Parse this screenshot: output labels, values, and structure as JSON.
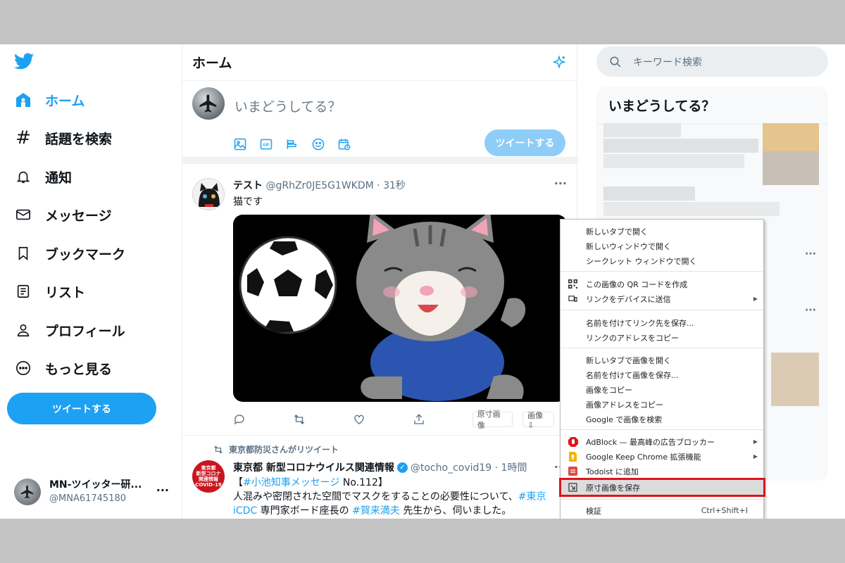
{
  "sidebar": {
    "logo": "twitter-bird-icon",
    "nav": [
      {
        "label": "ホーム",
        "icon": "home-icon",
        "active": true
      },
      {
        "label": "話題を検索",
        "icon": "hashtag-icon"
      },
      {
        "label": "通知",
        "icon": "bell-icon"
      },
      {
        "label": "メッセージ",
        "icon": "mail-icon"
      },
      {
        "label": "ブックマーク",
        "icon": "bookmark-icon"
      },
      {
        "label": "リスト",
        "icon": "list-icon"
      },
      {
        "label": "プロフィール",
        "icon": "person-icon"
      },
      {
        "label": "もっと見る",
        "icon": "more-circle-icon"
      }
    ],
    "tweet_button": "ツイートする",
    "account": {
      "name": "MN-ツイッター研...",
      "handle": "@MNA61745180",
      "more": "···"
    }
  },
  "home": {
    "title": "ホーム",
    "compose": {
      "placeholder": "いまどうしてる？",
      "tools": [
        "image-icon",
        "gif-icon",
        "poll-icon",
        "emoji-icon",
        "schedule-icon"
      ],
      "tweet_button": "ツイートする"
    },
    "tweet1": {
      "name": "テスト",
      "meta": "@gRhZr0JE5G1WKDM · 31秒",
      "body": "猫です",
      "more": "···",
      "ext_buttons": [
        "原寸画像",
        "画像⇩"
      ]
    },
    "tweet2": {
      "retweet_label": "東京都防災さんがリツイート",
      "avatar_lines": [
        "東京都",
        "新型コロナ",
        "関連情報",
        "COVID-19"
      ],
      "name": "東京都 新型コロナウイルス関連情報",
      "meta": "@tocho_covid19 · 1時間",
      "more": "···",
      "body_part1": "【",
      "hashtag1": "#小池知事メッセージ",
      "body_part2": " No.112】",
      "body_part3": "人混みや密閉された空間でマスクをすることの必要性について、",
      "hashtag2": "#東京iCDC",
      "body_part4": " 専門家ボード座長の ",
      "hashtag3": "#賀来満夫",
      "body_part5": " 先生から、伺いました。"
    }
  },
  "right": {
    "search_placeholder": "キーワード検索",
    "trends_title": "いまどうしてる？",
    "more": "···"
  },
  "context_menu": {
    "items": [
      {
        "label": "新しいタブで開く"
      },
      {
        "label": "新しいウィンドウで開く"
      },
      {
        "label": "シークレット ウィンドウで開く"
      },
      {
        "label": "この画像の QR コードを作成",
        "icon": "qr-code-icon"
      },
      {
        "label": "リンクをデバイスに送信",
        "icon": "device-send-icon",
        "submenu": true
      },
      {
        "label": "名前を付けてリンク先を保存..."
      },
      {
        "label": "リンクのアドレスをコピー"
      },
      {
        "label": "新しいタブで画像を開く"
      },
      {
        "label": "名前を付けて画像を保存..."
      },
      {
        "label": "画像をコピー"
      },
      {
        "label": "画像アドレスをコピー"
      },
      {
        "label": "Google で画像を検索"
      },
      {
        "label": "AdBlock — 最高峰の広告ブロッカー",
        "icon": "adblock-icon",
        "submenu": true
      },
      {
        "label": "Google Keep Chrome 拡張機能",
        "icon": "keep-icon",
        "submenu": true
      },
      {
        "label": "Todoist に追加",
        "icon": "todoist-icon"
      },
      {
        "label": "原寸画像を保存",
        "icon": "original-image-icon",
        "highlighted": true
      },
      {
        "label": "検証",
        "shortcut": "Ctrl+Shift+I"
      }
    ]
  },
  "colors": {
    "accent": "#1da1f2",
    "highlight_border": "#e0141b",
    "frame": "#c3c3c3"
  }
}
